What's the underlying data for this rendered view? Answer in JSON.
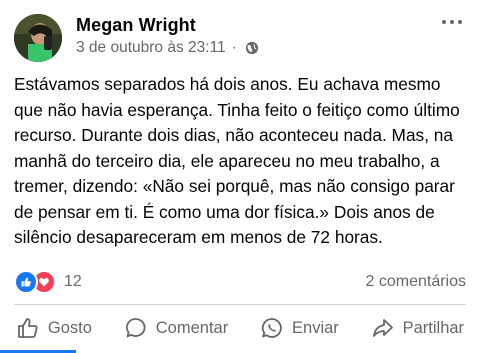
{
  "post": {
    "author": "Megan Wright",
    "timestamp": "3 de outubro às 23:11",
    "separator": "·",
    "privacy_icon": "globe-icon",
    "more_icon": "more-options-icon",
    "text": "Estávamos separados há dois anos. Eu achava mesmo\nque não havia esperança. Tinha feito o feitiço como último\nrecurso. Durante dois dias, não aconteceu nada. Mas, na\nmanhã do terceiro dia, ele apareceu no meu trabalho, a\ntremer, dizendo: «Não sei porquê, mas não consigo parar\nde pensar em ti. É como uma dor física.» Dois anos de\nsilêncio desapareceram em menos de 72 horas."
  },
  "reactions": {
    "count": "12",
    "comments": "2 comentários",
    "types": [
      "like-icon",
      "love-icon"
    ]
  },
  "actions": [
    {
      "label": "Gosto",
      "icon": "thumbs-up-icon"
    },
    {
      "label": "Comentar",
      "icon": "comment-icon"
    },
    {
      "label": "Enviar",
      "icon": "whatsapp-icon"
    },
    {
      "label": "Partilhar",
      "icon": "share-icon"
    }
  ],
  "colors": {
    "accent": "#1877f2",
    "love": "#f33e58",
    "secondary_text": "#65676b"
  }
}
